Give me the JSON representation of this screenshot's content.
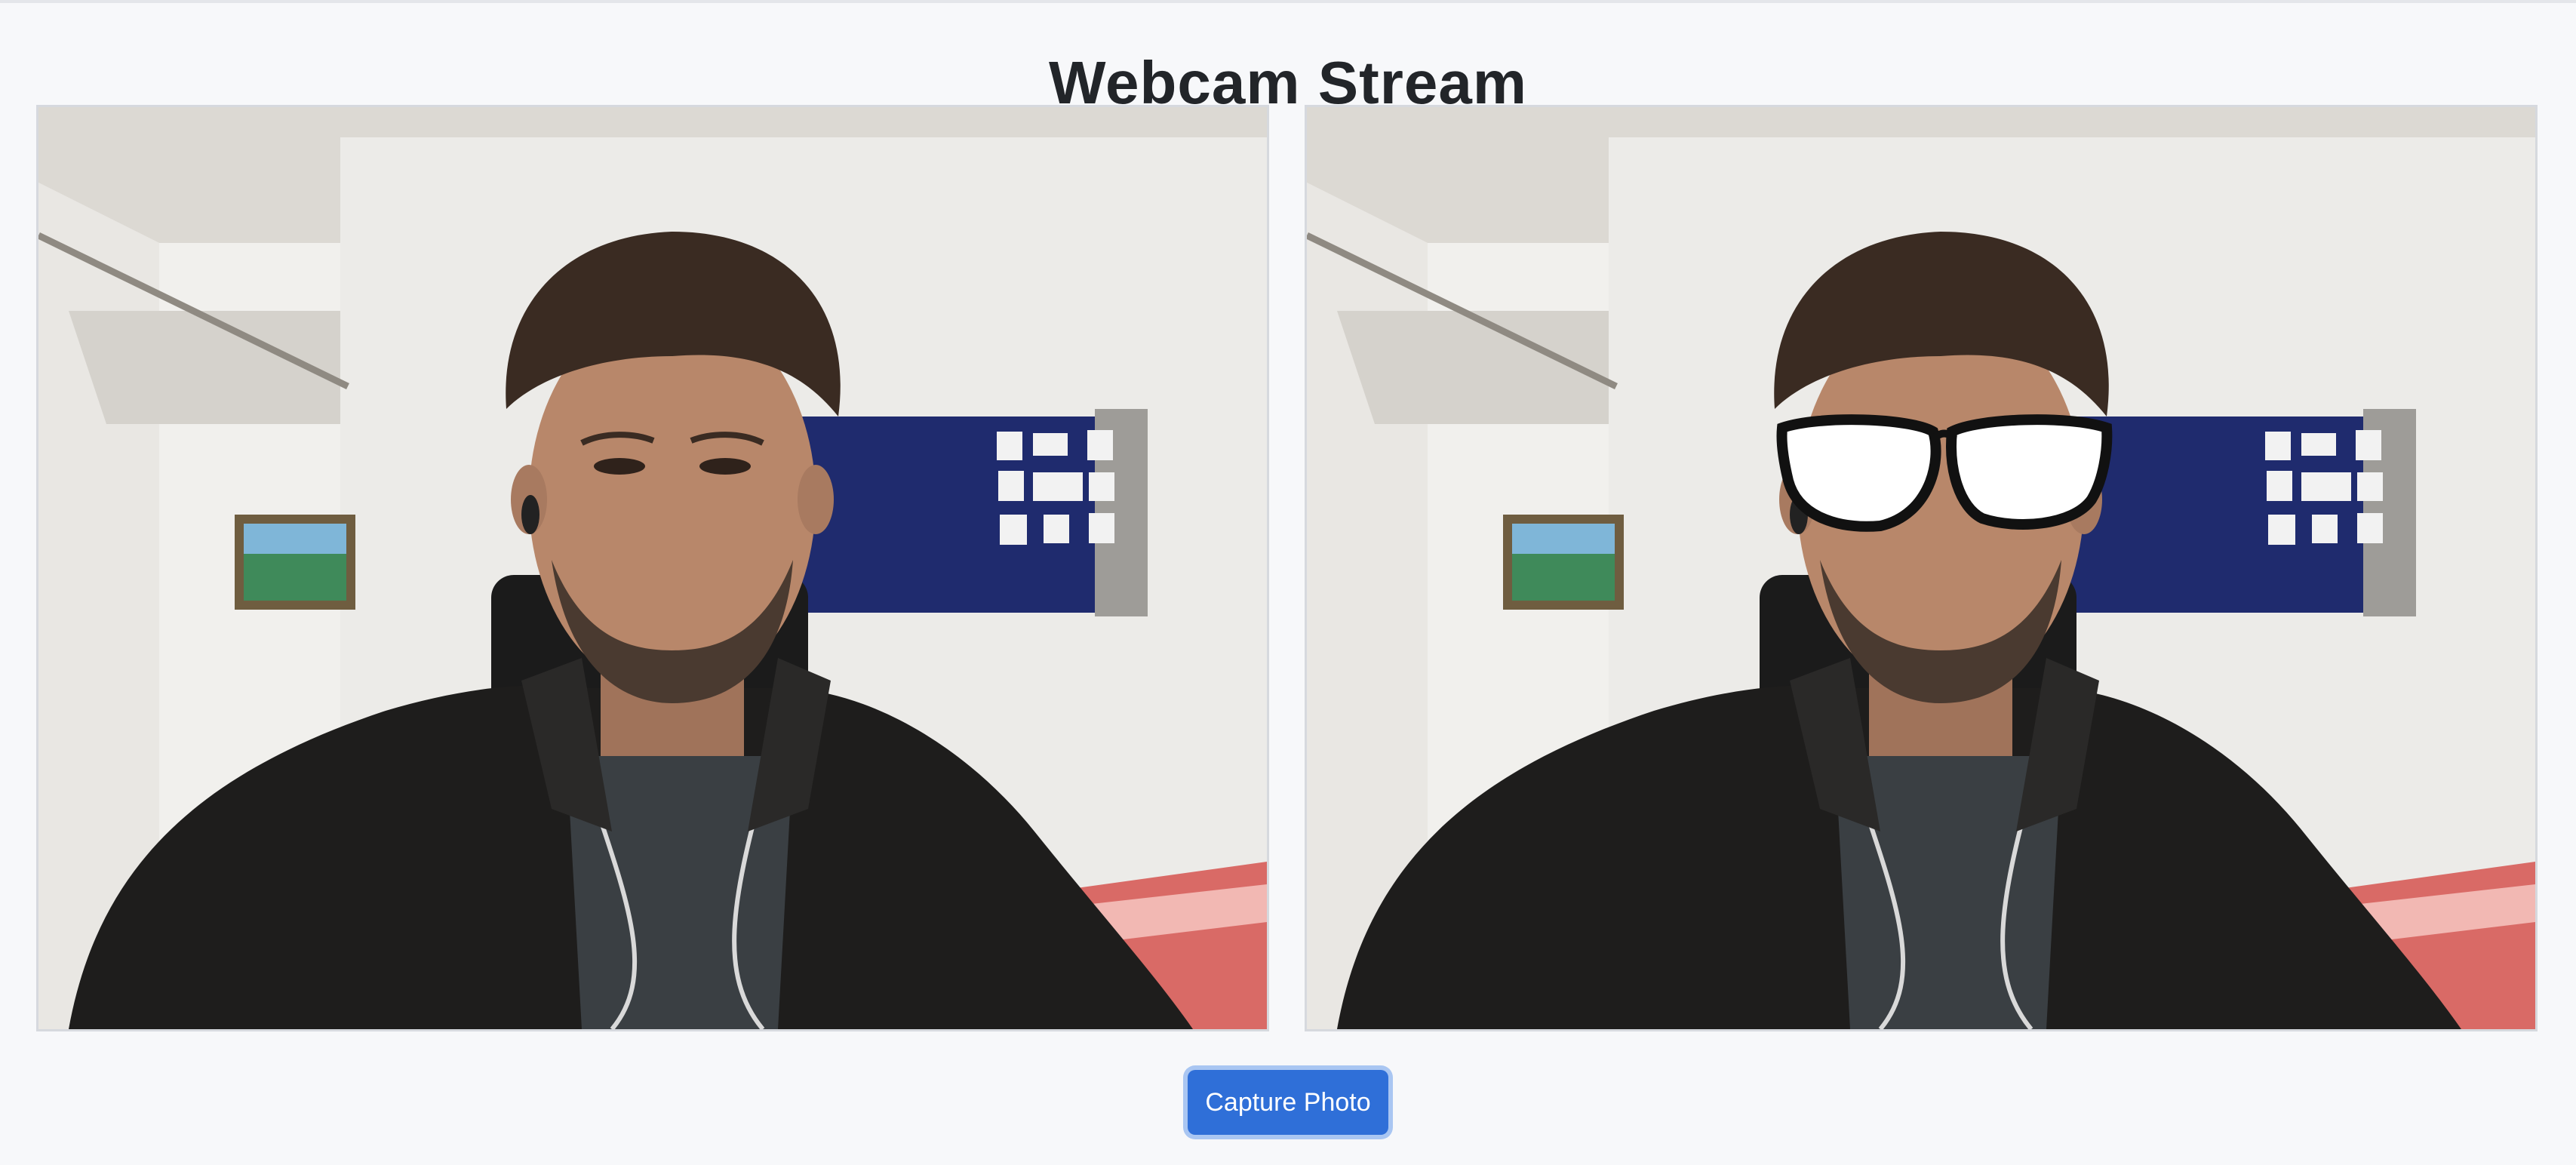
{
  "page": {
    "title": "Webcam Stream"
  },
  "views": [
    {
      "name": "raw-feed"
    },
    {
      "name": "filtered-feed",
      "overlay": "glasses"
    }
  ],
  "actions": {
    "capture_label": "Capture Photo"
  },
  "colors": {
    "accent": "#2f6fd8",
    "accent_ring": "#a9c6f2",
    "background": "#f7f8fa",
    "board": "#1f2b6e"
  },
  "footer": {
    "hint": ""
  }
}
